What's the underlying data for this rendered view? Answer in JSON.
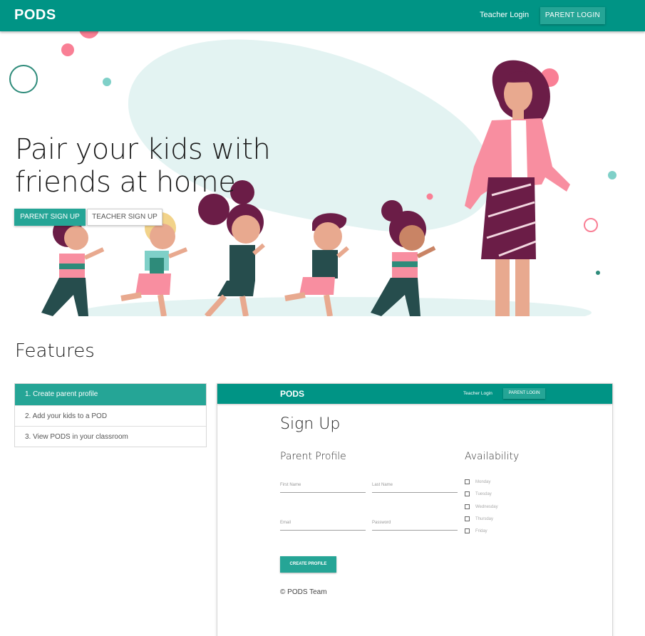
{
  "nav": {
    "brand": "PODS",
    "teacher_login": "Teacher Login",
    "parent_login": "PARENT LOGIN"
  },
  "hero": {
    "headline_line1": "Pair your kids with",
    "headline_line2": "friends at home",
    "parent_signup": "PARENT SIGN UP",
    "teacher_signup": "TEACHER SIGN UP"
  },
  "features": {
    "title": "Features",
    "items": [
      "1. Create parent profile",
      "2. Add your kids to a POD",
      "3. View PODS in your classroom"
    ]
  },
  "preview": {
    "brand": "PODS",
    "teacher_login": "Teacher Login",
    "parent_login": "PARENT LOGIN",
    "title": "Sign Up",
    "parent_profile": "Parent Profile",
    "availability": "Availability",
    "fields": {
      "first_name": "First Name",
      "last_name": "Last Name",
      "email": "Email",
      "password": "Password"
    },
    "days": [
      "Monday",
      "Tuesday",
      "Wednesday",
      "Thursday",
      "Friday"
    ],
    "create_profile": "CREATE PROFILE",
    "footer": "© PODS Team"
  },
  "colors": {
    "primary": "#009485",
    "button": "#25a596",
    "blob": "#e3f3f2",
    "pink": "#f97f95",
    "plum": "#6b1d47"
  }
}
